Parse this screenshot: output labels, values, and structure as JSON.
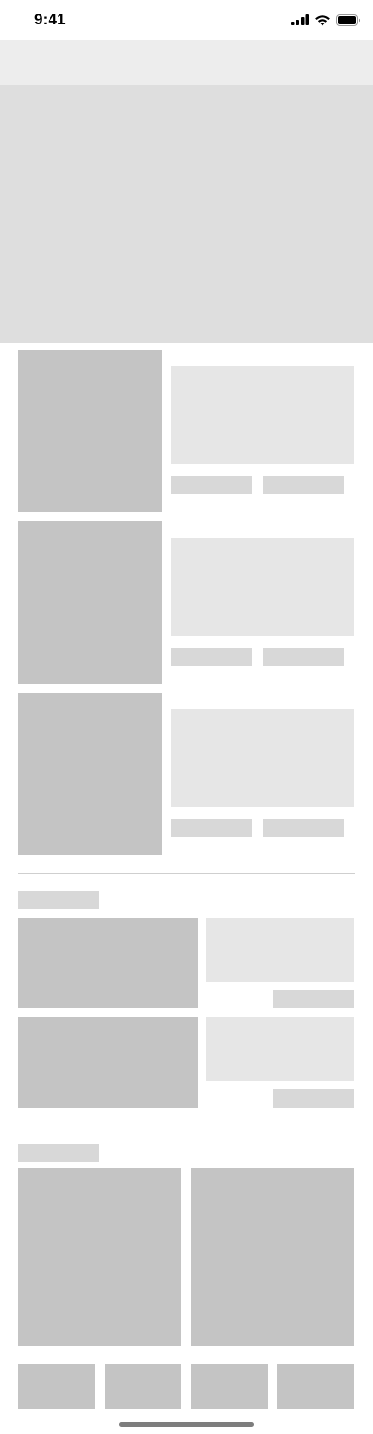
{
  "status_bar": {
    "time": "9:41",
    "icons": [
      "cellular-signal-icon",
      "wifi-icon",
      "battery-icon"
    ]
  },
  "colors": {
    "nav_bar": "#ededed",
    "hero": "#dedede",
    "image_placeholder": "#c4c4c4",
    "text_block_placeholder": "#e6e6e6",
    "small_label_placeholder": "#d8d8d8",
    "divider": "#cfcfcf"
  }
}
